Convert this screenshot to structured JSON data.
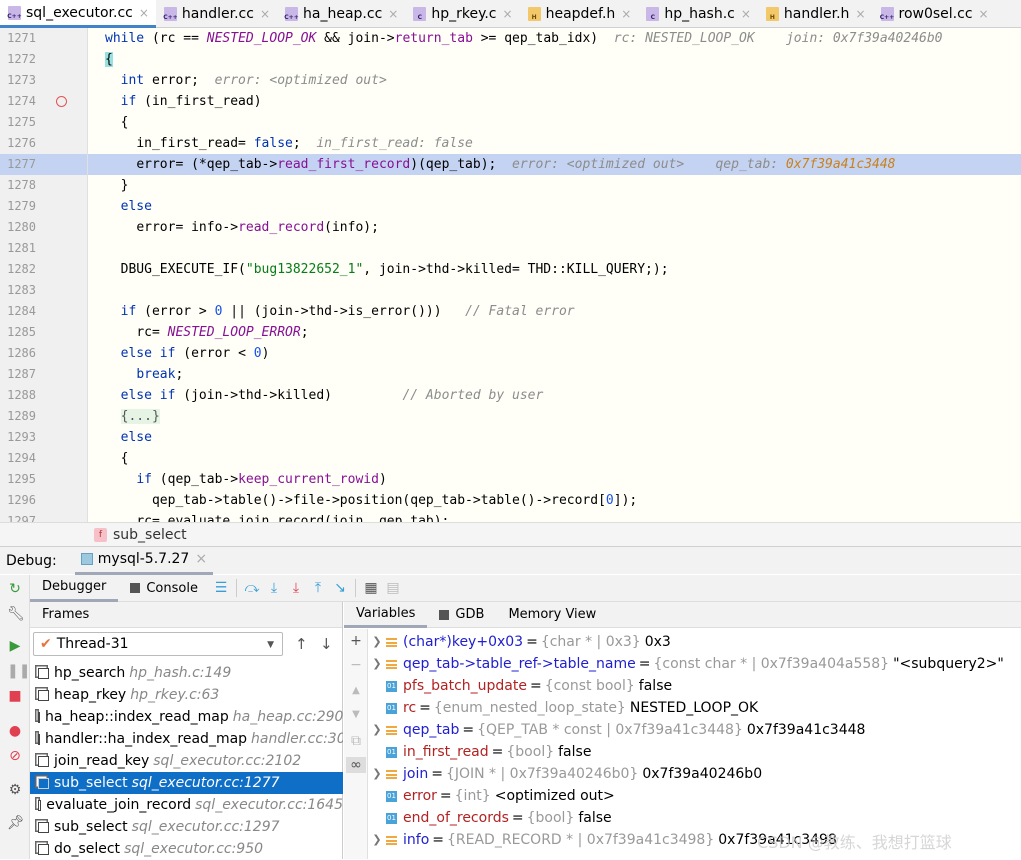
{
  "tabs": [
    {
      "label": "sql_executor.cc",
      "icon": "cpp",
      "active": true
    },
    {
      "label": "handler.cc",
      "icon": "cpp"
    },
    {
      "label": "ha_heap.cc",
      "icon": "cpp"
    },
    {
      "label": "hp_rkey.c",
      "icon": "c"
    },
    {
      "label": "heapdef.h",
      "icon": "h"
    },
    {
      "label": "hp_hash.c",
      "icon": "c"
    },
    {
      "label": "handler.h",
      "icon": "h"
    },
    {
      "label": "row0sel.cc",
      "icon": "cpp"
    }
  ],
  "code": {
    "lines": [
      {
        "n": "1271",
        "segs": [
          [
            "kw",
            "while"
          ],
          [
            "",
            "(rc == "
          ],
          [
            "mac",
            "NESTED_LOOP_OK"
          ],
          [
            "",
            " && join->"
          ],
          [
            "fn",
            "return_tab"
          ],
          [
            "",
            " >= qep_tab_idx)"
          ],
          [
            "hint",
            "rc: NESTED_LOOP_OK    join: 0x7f39a40246b0"
          ]
        ],
        "ind": 0
      },
      {
        "n": "1272",
        "segs": [
          [
            "brace",
            "{"
          ]
        ],
        "ind": 0
      },
      {
        "n": "1273",
        "segs": [
          [
            "kw",
            "int"
          ],
          [
            "",
            " error;"
          ],
          [
            "hint",
            "error: <optimized out>"
          ]
        ],
        "ind": 1
      },
      {
        "n": "1274",
        "segs": [
          [
            "kw",
            "if"
          ],
          [
            "",
            " (in_first_read)"
          ]
        ],
        "ind": 1,
        "bp": true
      },
      {
        "n": "1275",
        "segs": [
          [
            "",
            "{"
          ]
        ],
        "ind": 1
      },
      {
        "n": "1276",
        "segs": [
          [
            "",
            "in_first_read= "
          ],
          [
            "kw",
            "false"
          ],
          [
            "",
            ";"
          ],
          [
            "hint",
            "in_first_read: false"
          ]
        ],
        "ind": 2
      },
      {
        "n": "1277",
        "segs": [
          [
            "",
            "error= (*qep_tab->"
          ],
          [
            "fn",
            "read_first_record"
          ],
          [
            "",
            ")(qep_tab);"
          ],
          [
            "hint",
            "error: <optimized out>"
          ],
          [
            "hint",
            "  qep_tab: "
          ],
          [
            "hv",
            "0x7f39a41c3448"
          ]
        ],
        "ind": 2,
        "cur": true
      },
      {
        "n": "1278",
        "segs": [
          [
            "",
            "}"
          ]
        ],
        "ind": 1
      },
      {
        "n": "1279",
        "segs": [
          [
            "kw",
            "else"
          ]
        ],
        "ind": 1
      },
      {
        "n": "1280",
        "segs": [
          [
            "",
            "error= info->"
          ],
          [
            "fn",
            "read_record"
          ],
          [
            "",
            "(info);"
          ]
        ],
        "ind": 2
      },
      {
        "n": "1281",
        "segs": [],
        "ind": 0
      },
      {
        "n": "1282",
        "segs": [
          [
            "",
            "DBUG_EXECUTE_IF("
          ],
          [
            "str",
            "\"bug13822652_1\""
          ],
          [
            "",
            ", join->thd->killed= THD::KILL_QUERY;);"
          ]
        ],
        "ind": 1
      },
      {
        "n": "1283",
        "segs": [],
        "ind": 0
      },
      {
        "n": "1284",
        "segs": [
          [
            "kw",
            "if"
          ],
          [
            "",
            " (error > "
          ],
          [
            "num",
            "0"
          ],
          [
            "",
            " || (join->thd->is_error()))   "
          ],
          [
            "cm",
            "// Fatal error"
          ]
        ],
        "ind": 1
      },
      {
        "n": "1285",
        "segs": [
          [
            "",
            "rc= "
          ],
          [
            "mac",
            "NESTED_LOOP_ERROR"
          ],
          [
            "",
            ";"
          ]
        ],
        "ind": 2
      },
      {
        "n": "1286",
        "segs": [
          [
            "kw",
            "else if"
          ],
          [
            "",
            " (error < "
          ],
          [
            "num",
            "0"
          ],
          [
            "",
            ")"
          ]
        ],
        "ind": 1
      },
      {
        "n": "1287",
        "segs": [
          [
            "kw",
            "break"
          ],
          [
            "",
            ";"
          ]
        ],
        "ind": 2
      },
      {
        "n": "1288",
        "segs": [
          [
            "kw",
            "else if"
          ],
          [
            "",
            " (join->thd->killed)         "
          ],
          [
            "cm",
            "// Aborted by user"
          ]
        ],
        "ind": 1
      },
      {
        "n": "1289",
        "segs": [
          [
            "fold",
            "{...}"
          ]
        ],
        "ind": 1
      },
      {
        "n": "1293",
        "segs": [
          [
            "kw",
            "else"
          ]
        ],
        "ind": 1
      },
      {
        "n": "1294",
        "segs": [
          [
            "",
            "{"
          ]
        ],
        "ind": 1
      },
      {
        "n": "1295",
        "segs": [
          [
            "kw",
            "if"
          ],
          [
            "",
            " (qep_tab->"
          ],
          [
            "fn",
            "keep_current_rowid"
          ],
          [
            "",
            ")"
          ]
        ],
        "ind": 2
      },
      {
        "n": "1296",
        "segs": [
          [
            "",
            "qep_tab->table()->file->position(qep_tab->table()->record["
          ],
          [
            "num",
            "0"
          ],
          [
            "",
            "]);"
          ]
        ],
        "ind": 3
      },
      {
        "n": "1297",
        "segs": [
          [
            "",
            "rc= evaluate_join_record(join, qep_tab);"
          ]
        ],
        "ind": 2
      }
    ]
  },
  "breadcrumb": {
    "badge": "f",
    "label": "sub_select"
  },
  "debug": {
    "label": "Debug:",
    "session": "mysql-5.7.27"
  },
  "toolbar": {
    "debugger": "Debugger",
    "console": "Console"
  },
  "frames": {
    "header": "Frames",
    "thread": "Thread-31",
    "items": [
      {
        "fn": "hp_search",
        "loc": "hp_hash.c:149"
      },
      {
        "fn": "heap_rkey",
        "loc": "hp_rkey.c:63"
      },
      {
        "fn": "ha_heap::index_read_map",
        "loc": "ha_heap.cc:290"
      },
      {
        "fn": "handler::ha_index_read_map",
        "loc": "handler.cc:30"
      },
      {
        "fn": "join_read_key",
        "loc": "sql_executor.cc:2102"
      },
      {
        "fn": "sub_select",
        "loc": "sql_executor.cc:1277",
        "selected": true
      },
      {
        "fn": "evaluate_join_record",
        "loc": "sql_executor.cc:1645"
      },
      {
        "fn": "sub_select",
        "loc": "sql_executor.cc:1297"
      },
      {
        "fn": "do_select",
        "loc": "sql_executor.cc:950"
      }
    ]
  },
  "vars": {
    "tabs": [
      "Variables",
      "GDB",
      "Memory View"
    ],
    "items": [
      {
        "name": "(char*)key+0x03",
        "type": "{char * | 0x3}",
        "value": "0x3",
        "kind": "ptr",
        "exp": true
      },
      {
        "name": "qep_tab->table_ref->table_name",
        "type": "{const char * | 0x7f39a404a558}",
        "value": "\"<subquery2>\"",
        "kind": "ptr",
        "exp": true
      },
      {
        "name": "pfs_batch_update",
        "type": "{const bool}",
        "value": "false",
        "kind": "prim"
      },
      {
        "name": "rc",
        "type": "{enum_nested_loop_state}",
        "value": "NESTED_LOOP_OK",
        "kind": "prim"
      },
      {
        "name": "qep_tab",
        "type": "{QEP_TAB * const | 0x7f39a41c3448}",
        "value": "0x7f39a41c3448",
        "kind": "ptr",
        "exp": true
      },
      {
        "name": "in_first_read",
        "type": "{bool}",
        "value": "false",
        "kind": "prim"
      },
      {
        "name": "join",
        "type": "{JOIN * | 0x7f39a40246b0}",
        "value": "0x7f39a40246b0",
        "kind": "ptr",
        "exp": true
      },
      {
        "name": "error",
        "type": "{int}",
        "value": "<optimized out>",
        "kind": "prim"
      },
      {
        "name": "end_of_records",
        "type": "{bool}",
        "value": "false",
        "kind": "prim"
      },
      {
        "name": "info",
        "type": "{READ_RECORD * | 0x7f39a41c3498}",
        "value": "0x7f39a41c3498",
        "kind": "ptr",
        "exp": true
      }
    ]
  },
  "watermark": "CSDN @教练、我想打篮球"
}
